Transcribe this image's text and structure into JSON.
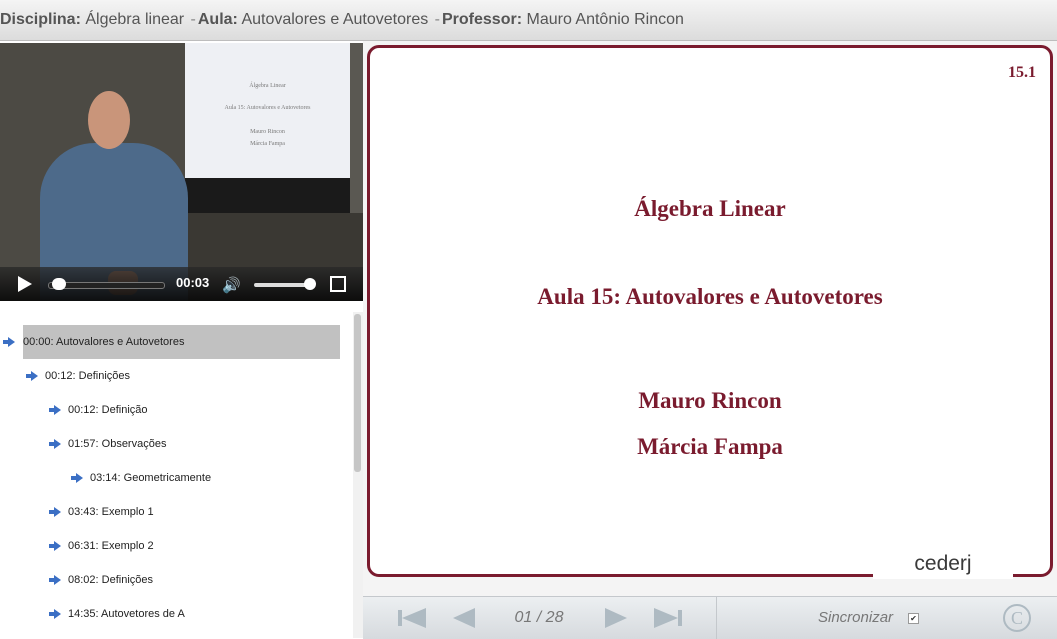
{
  "header": {
    "discipline_label": "Disciplina:",
    "discipline_value": "Álgebra linear",
    "separator1": "-",
    "lesson_label": "Aula:",
    "lesson_value": "Autovalores e Autovetores",
    "separator2": "-",
    "professor_label": "Professor:",
    "professor_value": "Mauro Antônio Rincon"
  },
  "video": {
    "time": "00:03",
    "projected_slide": [
      "Álgebra Linear",
      "Aula 15: Autovalores e Autovetores",
      "Mauro Rincon",
      "Márcia Fampa"
    ],
    "progress_fraction": 0.02,
    "volume_fraction": 0.9
  },
  "toc": [
    {
      "label": "00:00: Autovalores e Autovetores",
      "selected": true,
      "level": 0
    },
    {
      "label": "00:12: Definições",
      "selected": false,
      "level": 1
    },
    {
      "label": "00:12: Definição",
      "selected": false,
      "level": 2
    },
    {
      "label": "01:57: Observações",
      "selected": false,
      "level": 2
    },
    {
      "label": "03:14: Geometricamente",
      "selected": false,
      "level": 3
    },
    {
      "label": "03:43: Exemplo 1",
      "selected": false,
      "level": 2
    },
    {
      "label": "06:31: Exemplo 2",
      "selected": false,
      "level": 2
    },
    {
      "label": "08:02: Definições",
      "selected": false,
      "level": 2
    },
    {
      "label": "14:35: Autovetores de A",
      "selected": false,
      "level": 2
    }
  ],
  "slide": {
    "number": "15.1",
    "title": "Álgebra Linear",
    "subtitle": "Aula 15:  Autovalores e Autovetores",
    "author1": "Mauro Rincon",
    "author2": "Márcia Fampa",
    "logo": "cederj"
  },
  "navbar": {
    "page_indicator": "01 / 28",
    "sync_label": "Sincronizar",
    "sync_checked": true,
    "copyright_symbol": "C"
  },
  "colors": {
    "slide_accent": "#7a1b2e",
    "toc_arrow": "#3b6fc4",
    "toc_selected_bg": "#c1c1c1",
    "nav_icon": "#aebac2"
  }
}
